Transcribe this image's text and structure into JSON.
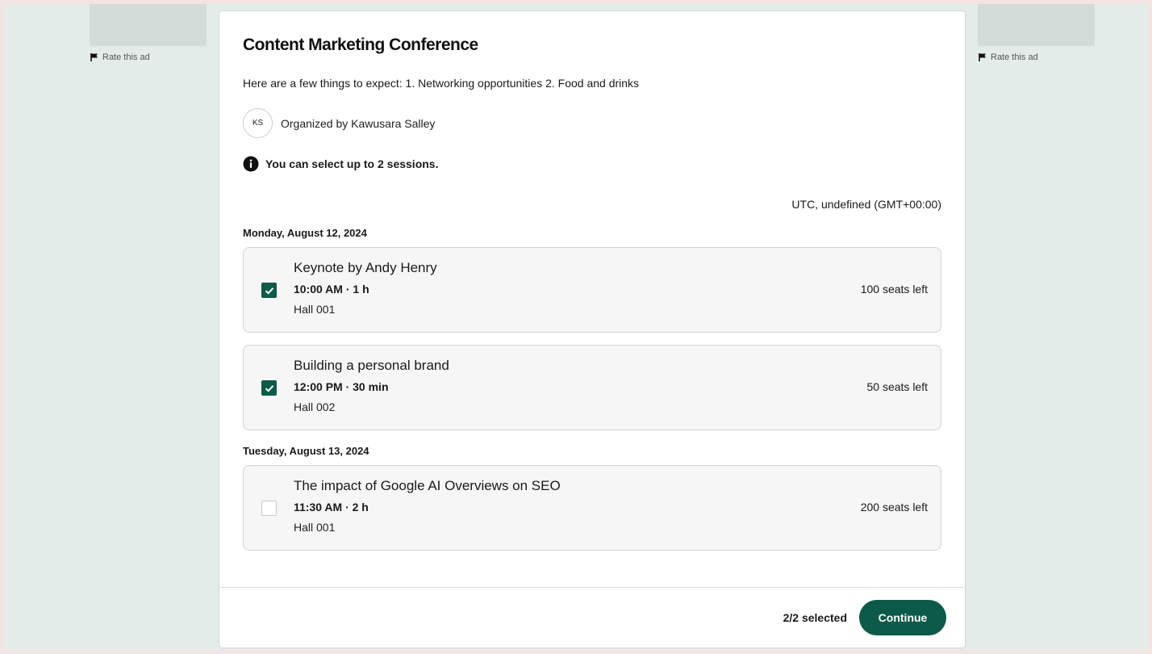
{
  "ads": {
    "left": {
      "rate_label": "Rate this ad"
    },
    "right": {
      "rate_label": "Rate this ad"
    }
  },
  "event": {
    "title": "Content Marketing Conference",
    "description": "Here are a few things to expect: 1. Networking opportunities 2. Food and drinks",
    "organizer_initials": "KS",
    "organizer_text": "Organized by Kawusara Salley",
    "notice": "You can select up to 2 sessions.",
    "timezone": "UTC, undefined (GMT+00:00)"
  },
  "days": [
    {
      "date": "Monday, August 12, 2024",
      "sessions": [
        {
          "name": "Keynote by Andy Henry",
          "time": "10:00 AM · 1 h",
          "hall": "Hall 001",
          "seats": "100 seats left",
          "checked": true
        },
        {
          "name": "Building a personal brand",
          "time": "12:00 PM · 30 min",
          "hall": "Hall 002",
          "seats": "50 seats left",
          "checked": true
        }
      ]
    },
    {
      "date": "Tuesday, August 13, 2024",
      "sessions": [
        {
          "name": "The impact of Google AI Overviews on SEO",
          "time": "11:30 AM · 2 h",
          "hall": "Hall 001",
          "seats": "200 seats left",
          "checked": false
        }
      ]
    }
  ],
  "footer": {
    "selected_count": "2/2 selected",
    "continue_label": "Continue"
  },
  "colors": {
    "accent": "#0c5a48",
    "page_background": "#e4ecea"
  }
}
